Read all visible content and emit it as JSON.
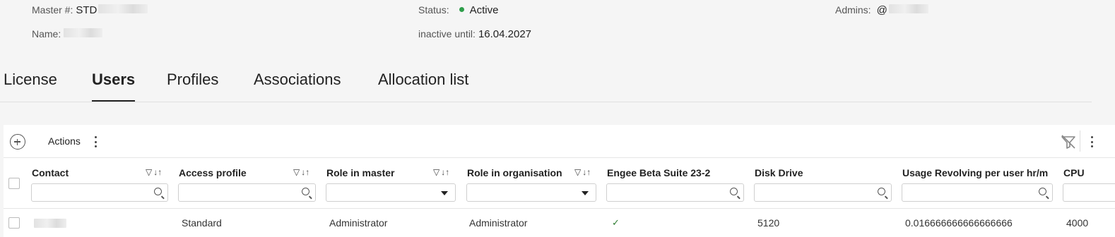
{
  "header": {
    "master_label": "Master #:",
    "master_value": "STD",
    "name_label": "Name:",
    "status_label": "Status:",
    "status_value": "Active",
    "inactive_label": "inactive until:",
    "inactive_value": "16.04.2027",
    "admins_label": "Admins:",
    "admins_value": "@"
  },
  "tabs": [
    {
      "label": "License",
      "active": false
    },
    {
      "label": "Users",
      "active": true
    },
    {
      "label": "Profiles",
      "active": false
    },
    {
      "label": "Associations",
      "active": false
    },
    {
      "label": "Allocation list",
      "active": false
    }
  ],
  "toolbar": {
    "actions_label": "Actions"
  },
  "table": {
    "columns": [
      {
        "title": "Contact",
        "sortable": true,
        "filter": "search"
      },
      {
        "title": "Access profile",
        "sortable": true,
        "filter": "search"
      },
      {
        "title": "Role in master",
        "sortable": true,
        "filter": "select"
      },
      {
        "title": "Role in organisation",
        "sortable": true,
        "filter": "select"
      },
      {
        "title": "Engee Beta Suite 23-2",
        "sortable": false,
        "filter": "search"
      },
      {
        "title": "Disk Drive",
        "sortable": false,
        "filter": "search"
      },
      {
        "title": "Usage Revolving per user hr/m",
        "sortable": false,
        "filter": "search"
      },
      {
        "title": "CPU",
        "sortable": false,
        "filter": "search"
      }
    ],
    "rows": [
      {
        "contact": "",
        "access_profile": "Standard",
        "role_in_master": "Administrator",
        "role_in_organisation": "Administrator",
        "engee_beta_suite": "✓",
        "disk_drive": "5120",
        "usage_revolving": "0.016666666666666666",
        "cpu": "4000"
      }
    ]
  },
  "colors": {
    "status_active": "#2e9e4a",
    "check_green": "#2e7d32"
  }
}
